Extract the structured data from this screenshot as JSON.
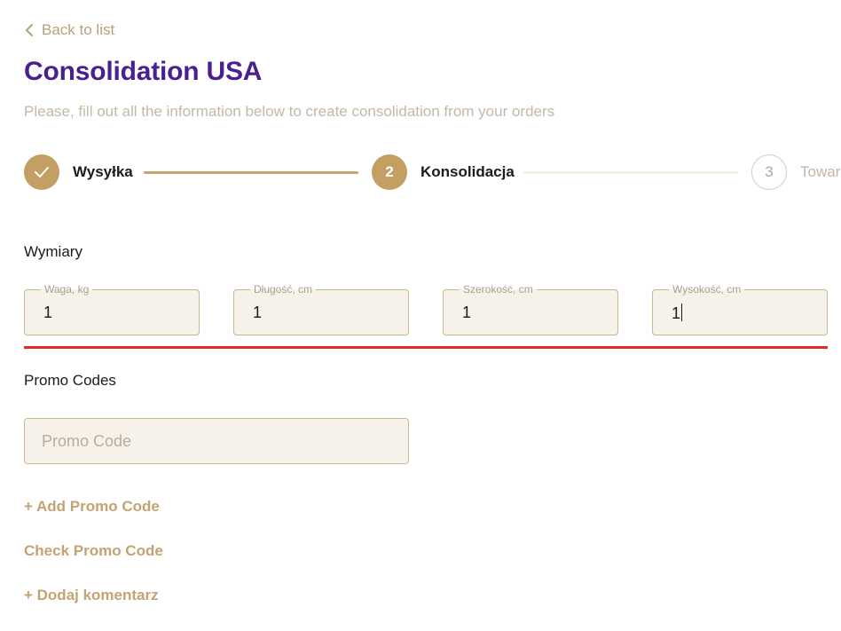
{
  "back_link": {
    "label": "Back to list",
    "icon": "chevron-left-icon"
  },
  "page": {
    "title": "Consolidation USA",
    "subtitle": "Please, fill out all the information below to create consolidation from your orders"
  },
  "stepper": {
    "steps": [
      {
        "label": "Wysyłka",
        "number": "",
        "state": "completed",
        "icon": "check-icon"
      },
      {
        "label": "Konsolidacja",
        "number": "2",
        "state": "active"
      },
      {
        "label": "Towar",
        "number": "3",
        "state": "pending"
      }
    ]
  },
  "dimensions": {
    "heading": "Wymiary",
    "fields": [
      {
        "label": "Waga, kg",
        "value": "1"
      },
      {
        "label": "Długość, cm",
        "value": "1"
      },
      {
        "label": "Szerokość, cm",
        "value": "1"
      },
      {
        "label": "Wysokość, cm",
        "value": "1"
      }
    ]
  },
  "promo": {
    "heading": "Promo Codes",
    "input": {
      "value": "",
      "placeholder": "Promo Code"
    },
    "add_label": "+ Add Promo Code",
    "check_label": "Check Promo Code"
  },
  "comment": {
    "add_label": "+ Dodaj komentarz"
  },
  "colors": {
    "accent": "#c49f63",
    "title": "#4a1f8f",
    "error_line": "#e32a2a",
    "field_background": "#f6f2ea"
  }
}
